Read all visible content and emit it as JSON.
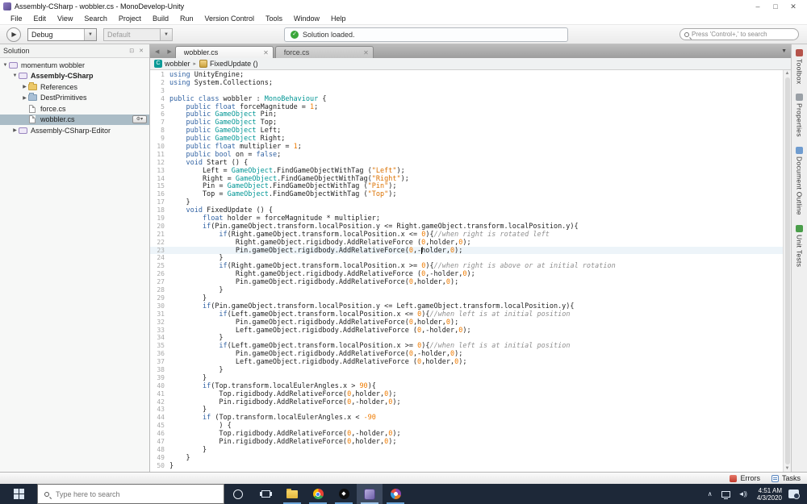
{
  "window": {
    "title": "Assembly-CSharp - wobbler.cs - MonoDevelop-Unity",
    "controls": {
      "minimize": "–",
      "maximize": "□",
      "close": "✕"
    }
  },
  "menu_bar": {
    "items": [
      "File",
      "Edit",
      "View",
      "Search",
      "Project",
      "Build",
      "Run",
      "Version Control",
      "Tools",
      "Window",
      "Help"
    ]
  },
  "toolbar": {
    "run_config": "Debug",
    "build_config": "Default",
    "status_message": "Solution loaded.",
    "check_glyph": "✓",
    "search_placeholder": "Press 'Control+,' to search"
  },
  "solution_panel": {
    "title": "Solution",
    "auto_hide_glyph": "⊡",
    "close_glyph": "✕",
    "tree": [
      {
        "label": "momentum wobbler",
        "level": 0,
        "expander": "open",
        "icon": "solution",
        "bold": false,
        "selected": false
      },
      {
        "label": "Assembly-CSharp",
        "level": 1,
        "expander": "open",
        "icon": "project",
        "bold": true,
        "selected": false
      },
      {
        "label": "References",
        "level": 2,
        "expander": "closed",
        "icon": "folder-yellow",
        "bold": false,
        "selected": false
      },
      {
        "label": "DestPrimitives",
        "level": 2,
        "expander": "closed",
        "icon": "folder-blue",
        "bold": false,
        "selected": false
      },
      {
        "label": "force.cs",
        "level": 2,
        "expander": "none",
        "icon": "file",
        "bold": false,
        "selected": false
      },
      {
        "label": "wobbler.cs",
        "level": 2,
        "expander": "none",
        "icon": "file",
        "bold": false,
        "selected": true,
        "gear_glyph": "⚙▾"
      },
      {
        "label": "Assembly-CSharp-Editor",
        "level": 1,
        "expander": "closed",
        "icon": "project",
        "bold": false,
        "selected": false
      }
    ]
  },
  "editor": {
    "nav_left_glyph": "◀",
    "nav_right_glyph": "▶",
    "tab_overflow_glyph": "▼",
    "tabs": [
      {
        "label": "wobbler.cs",
        "close_glyph": "✕",
        "active": true
      },
      {
        "label": "force.cs",
        "close_glyph": "✕",
        "active": false
      }
    ],
    "breadcrumb": [
      {
        "icon": "csharp",
        "icon_glyph": "C",
        "label": "wobbler"
      },
      {
        "icon": "method",
        "icon_glyph": "",
        "label": "FixedUpdate ()"
      }
    ],
    "breadcrumb_sep": "▸",
    "scroll_up_glyph": "▲",
    "scroll_down_glyph": "▼",
    "caret": {
      "line": 23,
      "col": 61
    },
    "code_lines": [
      "using UnityEngine;",
      "using System.Collections;",
      "",
      "public class wobbler : MonoBehaviour {",
      "    public float forceMagnitude = 1;",
      "    public GameObject Pin;",
      "    public GameObject Top;",
      "    public GameObject Left;",
      "    public GameObject Right;",
      "    public float multiplier = 1;",
      "    public bool on = false;",
      "    void Start () {",
      "        Left = GameObject.FindGameObjectWithTag (\"Left\");",
      "        Right = GameObject.FindGameObjectWithTag(\"Right\");",
      "        Pin = GameObject.FindGameObjectWithTag (\"Pin\");",
      "        Top = GameObject.FindGameObjectWithTag (\"Top\");",
      "    }",
      "    void FixedUpdate () {",
      "        float holder = forceMagnitude * multiplier;",
      "        if(Pin.gameObject.transform.localPosition.y <= Right.gameObject.transform.localPosition.y){",
      "            if(Right.gameObject.transform.localPosition.x <= 0){//when right is rotated left",
      "                Right.gameObject.rigidbody.AddRelativeForce (0,holder,0);",
      "                Pin.gameObject.rigidbody.AddRelativeForce(0,-holder,0);",
      "            }",
      "            if(Right.gameObject.transform.localPosition.x >= 0){//when right is above or at initial rotation",
      "                Right.gameObject.rigidbody.AddRelativeForce (0,-holder,0);",
      "                Pin.gameObject.rigidbody.AddRelativeForce(0,holder,0);",
      "            }",
      "        }",
      "        if(Pin.gameObject.transform.localPosition.y <= Left.gameObject.transform.localPosition.y){",
      "            if(Left.gameObject.transform.localPosition.x <= 0){//when left is at initial position",
      "                Pin.gameObject.rigidbody.AddRelativeForce(0,holder,0);",
      "                Left.gameObject.rigidbody.AddRelativeForce (0,-holder,0);",
      "            }",
      "            if(Left.gameObject.transform.localPosition.x >= 0){//when left is at initial position",
      "                Pin.gameObject.rigidbody.AddRelativeForce(0,-holder,0);",
      "                Left.gameObject.rigidbody.AddRelativeForce (0,holder,0);",
      "            }",
      "        }",
      "        if(Top.transform.localEulerAngles.x > 90){",
      "            Top.rigidbody.AddRelativeForce(0,holder,0);",
      "            Pin.rigidbody.AddRelativeForce(0,-holder,0);",
      "        }",
      "        if (Top.transform.localEulerAngles.x < -90",
      "            ) {",
      "            Top.rigidbody.AddRelativeForce(0,-holder,0);",
      "            Pin.rigidbody.AddRelativeForce(0,holder,0);",
      "        }",
      "    }",
      "}"
    ]
  },
  "right_dock": {
    "tabs": [
      {
        "label": "Toolbox",
        "icon": "toolbox"
      },
      {
        "label": "Properties",
        "icon": "properties"
      },
      {
        "label": "Document Outline",
        "icon": "document-outline"
      },
      {
        "label": "Unit Tests",
        "icon": "unit-tests"
      }
    ]
  },
  "status_bar": {
    "errors_label": "Errors",
    "tasks_label": "Tasks"
  },
  "taskbar": {
    "search_placeholder": "Type here to search",
    "apps": [
      {
        "name": "file-explorer",
        "icon": "folder",
        "open": true,
        "active": false
      },
      {
        "name": "chrome",
        "icon": "chrome",
        "open": true,
        "active": false
      },
      {
        "name": "unity",
        "icon": "unity",
        "icon_glyph": "◆",
        "open": true,
        "active": false
      },
      {
        "name": "monodevelop",
        "icon": "monodev",
        "open": true,
        "active": true
      },
      {
        "name": "paint-3d",
        "icon": "paint",
        "open": true,
        "active": false
      }
    ],
    "tray": {
      "chevron_glyph": "∧",
      "volume_glyph": "◄))",
      "time": "4:51 AM",
      "date": "4/3/2020"
    }
  },
  "colors": {
    "accent_teal": "#009695",
    "keyword_blue": "#3364a4",
    "string_orange": "#db7100",
    "number_orange": "#ef7b00",
    "comment_gray": "#8f8f8f",
    "status_green": "#3aa63a",
    "tree_selection": "#aabcc6",
    "taskbar_bg": "#1d2838",
    "taskbar_underline": "#6ba3d6"
  }
}
